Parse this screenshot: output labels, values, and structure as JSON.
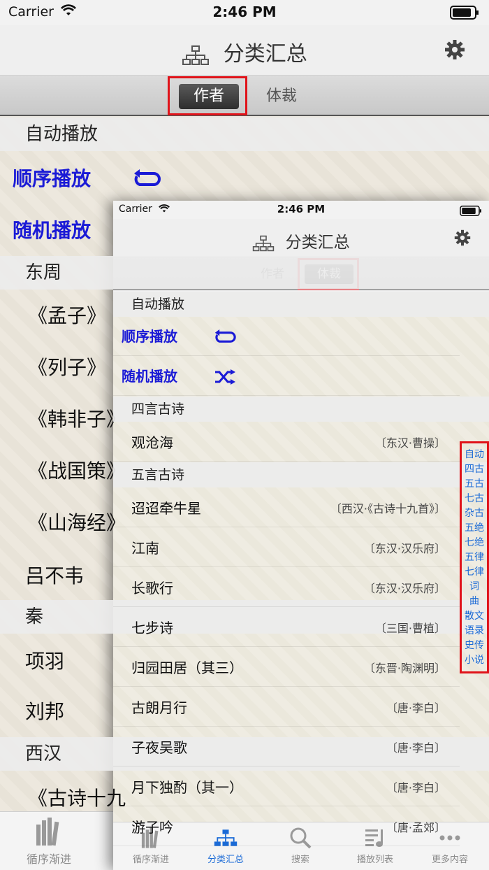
{
  "status": {
    "carrier": "Carrier",
    "time": "2:46 PM"
  },
  "nav": {
    "title": "分类汇总"
  },
  "segments": {
    "author": "作者",
    "genre": "体裁"
  },
  "background": {
    "auto_play_header": "自动播放",
    "sequential_play": "顺序播放",
    "random_play": "随机播放",
    "rows": [
      {
        "type": "header",
        "text": "东周"
      },
      {
        "type": "item",
        "text": "《孟子》"
      },
      {
        "type": "item",
        "text": "《列子》"
      },
      {
        "type": "item",
        "text": "《韩非子》"
      },
      {
        "type": "item",
        "text": "《战国策》"
      },
      {
        "type": "item",
        "text": "《山海经》"
      },
      {
        "type": "plain",
        "text": "吕不韦"
      },
      {
        "type": "header",
        "text": "秦"
      },
      {
        "type": "plain",
        "text": "项羽"
      },
      {
        "type": "plain",
        "text": "刘邦"
      },
      {
        "type": "header",
        "text": "西汉"
      },
      {
        "type": "item",
        "text": "《古诗十九"
      }
    ],
    "tab_first": "循序渐进"
  },
  "foreground": {
    "auto_play_header": "自动播放",
    "sequential_play": "顺序播放",
    "random_play": "随机播放",
    "sections": [
      {
        "header": "四言古诗",
        "poems": [
          {
            "title": "观沧海",
            "author": "〔东汉·曹操〕"
          }
        ]
      },
      {
        "header": "五言古诗",
        "poems": [
          {
            "title": "迢迢牵牛星",
            "author": "〔西汉·《古诗十九首》〕"
          },
          {
            "title": "江南",
            "author": "〔东汉·汉乐府〕"
          },
          {
            "title": "长歌行",
            "author": "〔东汉·汉乐府〕"
          },
          {
            "title": "七步诗",
            "author": "〔三国·曹植〕"
          },
          {
            "title": "归园田居（其三）",
            "author": "〔东晋·陶渊明〕"
          },
          {
            "title": "古朗月行",
            "author": "〔唐·李白〕"
          },
          {
            "title": "子夜吴歌",
            "author": "〔唐·李白〕"
          },
          {
            "title": "月下独酌（其一）",
            "author": "〔唐·李白〕"
          },
          {
            "title": "游子吟",
            "author": "〔唐·孟郊〕"
          }
        ]
      }
    ],
    "index": [
      "自动",
      "四古",
      "五古",
      "七古",
      "杂古",
      "五绝",
      "七绝",
      "五律",
      "七律",
      "词",
      "曲",
      "散文",
      "语录",
      "史传",
      "小说"
    ],
    "tabs": [
      "循序渐进",
      "分类汇总",
      "搜索",
      "播放列表",
      "更多内容"
    ],
    "active_tab": 1
  },
  "colors": {
    "accent_blue": "#1a6ad6",
    "play_blue": "#1a1ad6",
    "highlight_red": "#e0131a"
  }
}
